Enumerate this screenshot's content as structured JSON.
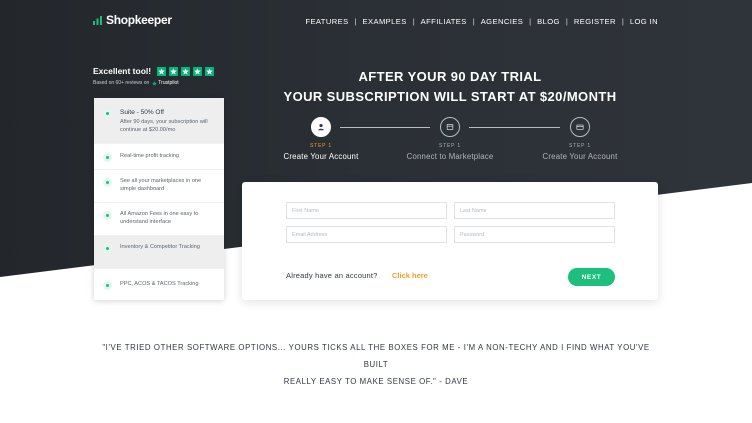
{
  "brand": {
    "name": "Shopkeeper"
  },
  "nav": {
    "items": [
      "FEATURES",
      "EXAMPLES",
      "AFFILIATES",
      "AGENCIES",
      "BLOG",
      "REGISTER",
      "LOG IN"
    ]
  },
  "trustpilot": {
    "title": "Excellent tool!",
    "rating_stars": 5,
    "sub": "Based on 60+ reviews on",
    "brand": "Trustpilot"
  },
  "features": [
    {
      "title": "Suite - 50% Off",
      "desc": "After 90 days, your subscription will continue at $20.00/mo",
      "icon": "tag-icon"
    },
    {
      "text": "Real-time profit tracking",
      "icon": "search-icon"
    },
    {
      "text": "See all your marketplaces in one simple dashboard",
      "icon": "gear-icon"
    },
    {
      "text": "All Amazon Fees in one easy to understand interface",
      "icon": "fees-icon"
    },
    {
      "text": "Inventory & Competitor Tracking",
      "icon": "inventory-icon"
    },
    {
      "text": "PPC, ACOS & TACOS Tracking",
      "icon": "info-icon"
    }
  ],
  "heading": {
    "line1": "AFTER YOUR 90 DAY TRIAL",
    "line2": "YOUR SUBSCRIPTION WILL START AT $20/MONTH"
  },
  "steps": [
    {
      "num": "STEP 1",
      "label": "Create Your Account",
      "icon": "user-icon"
    },
    {
      "num": "STEP 1",
      "label": "Connect to Marketplace",
      "icon": "store-icon"
    },
    {
      "num": "STEP 1",
      "label": "Create Your Account",
      "icon": "card-icon"
    }
  ],
  "form": {
    "first_name_placeholder": "First Name",
    "last_name_placeholder": "Last Name",
    "email_placeholder": "Email Address",
    "password_placeholder": "Password",
    "account_prompt": "Already have an account?",
    "login_link": "Click here",
    "next_label": "NEXT"
  },
  "quote": {
    "line1": "\"I'VE TRIED OTHER SOFTWARE OPTIONS... YOURS TICKS ALL THE BOXES FOR ME - I'M A NON-TECHY AND I FIND WHAT YOU'VE BUILT",
    "line2": "REALLY EASY TO MAKE SENSE OF.\" - DAVE"
  },
  "colors": {
    "hero_dark": "#262b31",
    "accent_green": "#1dbf7c",
    "accent_orange": "#f29d2b",
    "trustpilot_green": "#00b67a"
  }
}
